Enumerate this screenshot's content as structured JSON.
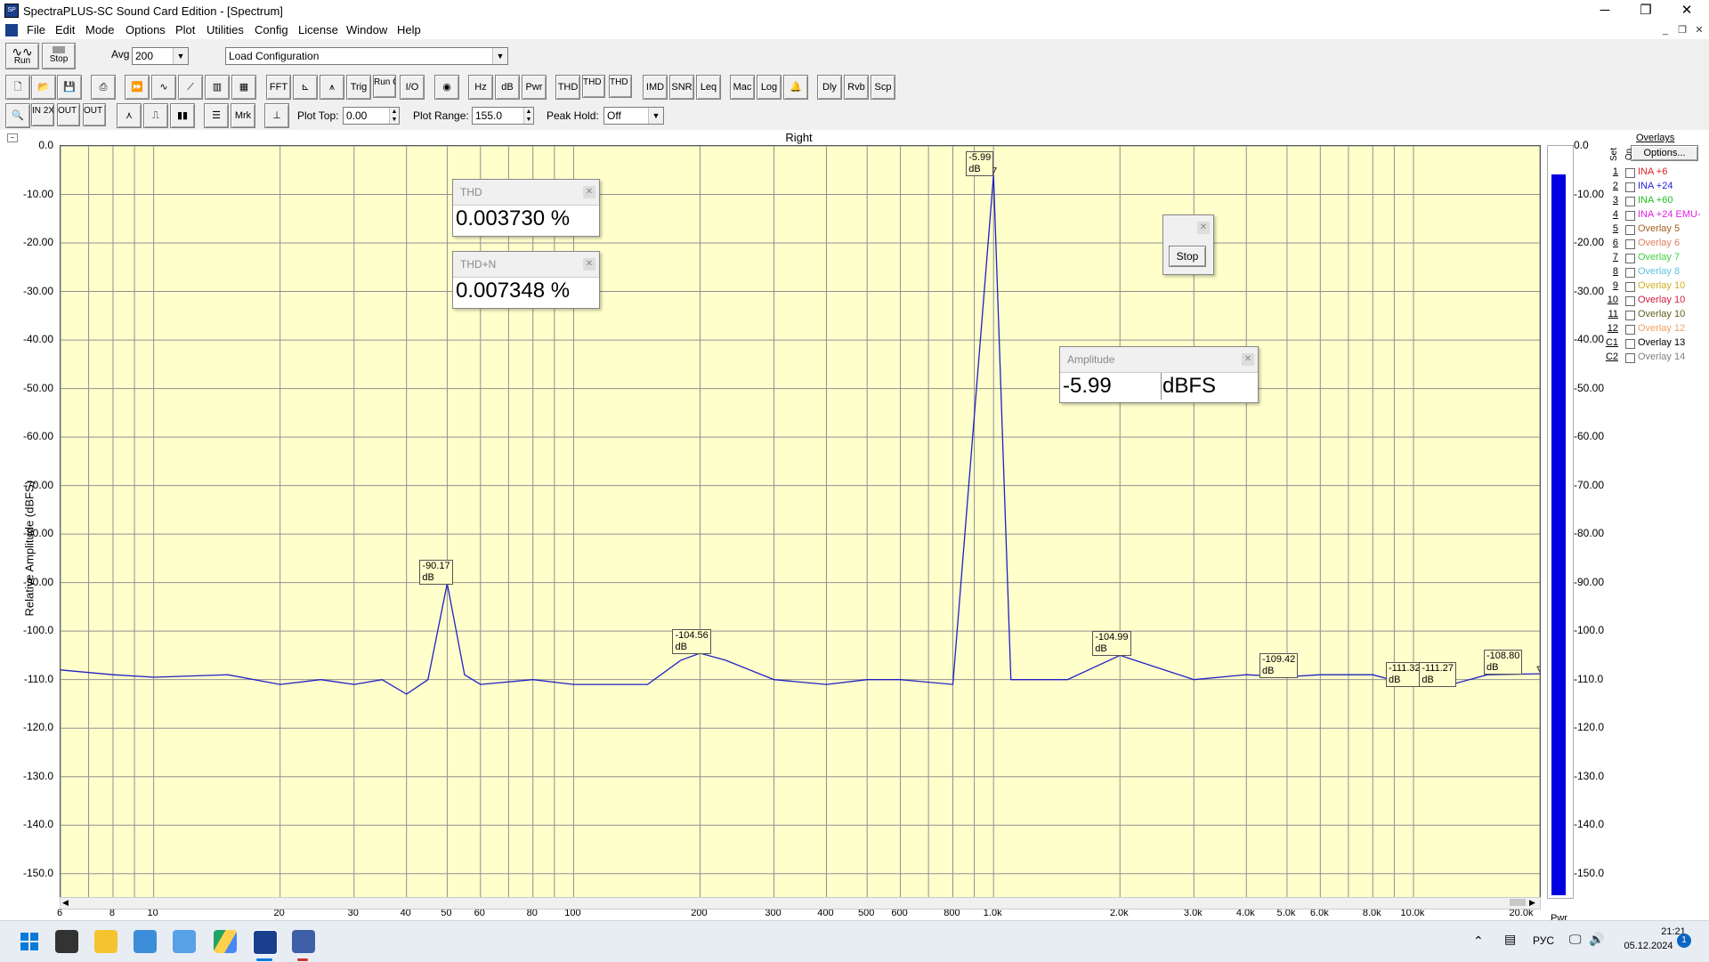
{
  "window": {
    "title": "SpectraPLUS-SC Sound Card Edition - [Spectrum]",
    "app_icon": "spectrum-app-icon",
    "controls": [
      "minimize",
      "maximize",
      "close"
    ]
  },
  "menu": {
    "items": [
      "File",
      "Edit",
      "Mode",
      "Options",
      "Plot",
      "Utilities",
      "Config",
      "License",
      "Window",
      "Help"
    ]
  },
  "toolbar1": {
    "run_label": "Run",
    "stop_label": "Stop",
    "avg_label": "Avg",
    "avg_value": "200",
    "config_value": "Load Configuration"
  },
  "toolbar2": {
    "buttons": [
      "FFT",
      "Trig",
      "Run Ctrl",
      "I/O",
      "Hz",
      "dB",
      "Pwr",
      "THD",
      "THD +N",
      "THD Freq",
      "IMD",
      "SNR",
      "Leq",
      "Mac",
      "Log",
      "Dly",
      "Rvb",
      "Scp"
    ]
  },
  "toolbar3": {
    "mrk_label": "Mrk",
    "plot_top_label": "Plot Top:",
    "plot_top_value": "0.00",
    "plot_range_label": "Plot Range:",
    "plot_range_value": "155.0",
    "peak_hold_label": "Peak Hold:",
    "peak_hold_value": "Off"
  },
  "plot": {
    "channel_title": "Right",
    "ylabel": "Relative Amplitude (dBFS)",
    "yticks": [
      "0.0",
      "-10.00",
      "-20.00",
      "-30.00",
      "-40.00",
      "-50.00",
      "-60.00",
      "-70.00",
      "-80.00",
      "-90.00",
      "-100.0",
      "-110.0",
      "-120.0",
      "-130.0",
      "-140.0",
      "-150.0"
    ],
    "xticks": [
      "6",
      "8",
      "10",
      "20",
      "30",
      "40",
      "50",
      "60",
      "80",
      "100",
      "200",
      "300",
      "400",
      "500",
      "600",
      "800",
      "1.0k",
      "2.0k",
      "3.0k",
      "4.0k",
      "5.0k",
      "6.0k",
      "8.0k",
      "10.0k",
      "20.0k"
    ],
    "x_units_label": "Pwr",
    "peaks": [
      "-5.99 dB",
      "-90.17 dB",
      "-104.56 dB",
      "-104.99 dB",
      "-109.42 dB",
      "-111.32 dB",
      "-111.27 dB",
      "-108.80 dB"
    ]
  },
  "chart_data": {
    "type": "line",
    "title": "Right",
    "xlabel": "",
    "ylabel": "Relative Amplitude (dBFS)",
    "xscale": "log",
    "xlim": [
      6,
      20000
    ],
    "ylim": [
      -155,
      0
    ],
    "grid": true,
    "series": [
      {
        "x": [
          6,
          8,
          10,
          15,
          20,
          25,
          30,
          35,
          40,
          45,
          50,
          55,
          60,
          80,
          100,
          150,
          180,
          200,
          230,
          300,
          400,
          500,
          600,
          800,
          1000,
          1100,
          1500,
          2000,
          3000,
          4000,
          5000,
          6000,
          8000,
          10000,
          12000,
          15000,
          20000
        ],
        "values": [
          -108,
          -109,
          -109.5,
          -109,
          -111,
          -110,
          -111,
          -110,
          -113,
          -110,
          -90.17,
          -109,
          -111,
          -110,
          -111,
          -111,
          -106,
          -104.56,
          -106,
          -110,
          -111,
          -110,
          -110,
          -111,
          -5.99,
          -110,
          -110,
          -104.99,
          -110,
          -109,
          -109.42,
          -109,
          -109,
          -111.32,
          -111.27,
          -109,
          -108.8
        ]
      }
    ],
    "annotations": [
      {
        "x": 1000,
        "y": -5.99,
        "text": "-5.99 dB"
      },
      {
        "x": 50,
        "y": -90.17,
        "text": "-90.17 dB"
      },
      {
        "x": 200,
        "y": -104.56,
        "text": "-104.56 dB"
      },
      {
        "x": 2000,
        "y": -104.99,
        "text": "-104.99 dB"
      },
      {
        "x": 5000,
        "y": -109.42,
        "text": "-109.42 dB"
      },
      {
        "x": 10000,
        "y": -111.32,
        "text": "-111.32 dB"
      },
      {
        "x": 12000,
        "y": -111.27,
        "text": "-111.27 dB"
      },
      {
        "x": 20000,
        "y": -108.8,
        "text": "-108.80 dB"
      }
    ]
  },
  "meters": {
    "thd_title": "THD",
    "thd_value": "0.003730 %",
    "thdn_title": "THD+N",
    "thdn_value": "0.007348 %",
    "amp_title": "Amplitude",
    "amp_value": "-5.99",
    "amp_unit": "dBFS",
    "stop_label": "Stop"
  },
  "level_meter": {
    "ticks": [
      "0.0",
      "-10.00",
      "-20.00",
      "-30.00",
      "-40.00",
      "-50.00",
      "-60.00",
      "-70.00",
      "-80.00",
      "-90.00",
      "-100.0",
      "-110.0",
      "-120.0",
      "-130.0",
      "-140.0",
      "-150.0"
    ],
    "fill_color": "#0000e0"
  },
  "overlays": {
    "title": "Overlays",
    "options_label": "Options...",
    "set_label": "Set",
    "on_label": "On",
    "items": [
      {
        "num": "1",
        "name": "INA +6",
        "color": "#e02020"
      },
      {
        "num": "2",
        "name": "INA +24",
        "color": "#2020e0"
      },
      {
        "num": "3",
        "name": "INA +60",
        "color": "#20c020"
      },
      {
        "num": "4",
        "name": "INA +24 EMU-",
        "color": "#e020e0"
      },
      {
        "num": "5",
        "name": "Overlay 5",
        "color": "#a06020"
      },
      {
        "num": "6",
        "name": "Overlay 6",
        "color": "#e08060"
      },
      {
        "num": "7",
        "name": "Overlay 7",
        "color": "#40d040"
      },
      {
        "num": "8",
        "name": "Overlay 8",
        "color": "#60c0e0"
      },
      {
        "num": "9",
        "name": "Overlay 10",
        "color": "#d0b020"
      },
      {
        "num": "10",
        "name": "Overlay 10",
        "color": "#d02040"
      },
      {
        "num": "11",
        "name": "Overlay 10",
        "color": "#606020"
      },
      {
        "num": "12",
        "name": "Overlay 12",
        "color": "#f0a060"
      },
      {
        "num": "C1",
        "name": "Overlay 13",
        "color": "#000000"
      },
      {
        "num": "C2",
        "name": "Overlay 14",
        "color": "#808080"
      }
    ]
  },
  "taskbar": {
    "icons": [
      "windows-start-icon",
      "terminal-icon",
      "folder-icon",
      "photos-icon",
      "widgets-icon",
      "google-drive-icon",
      "spectraplus-icon",
      "app-icon"
    ],
    "lang": "РУС",
    "time": "21:21",
    "date": "05.12.2024",
    "notif_count": "1"
  }
}
